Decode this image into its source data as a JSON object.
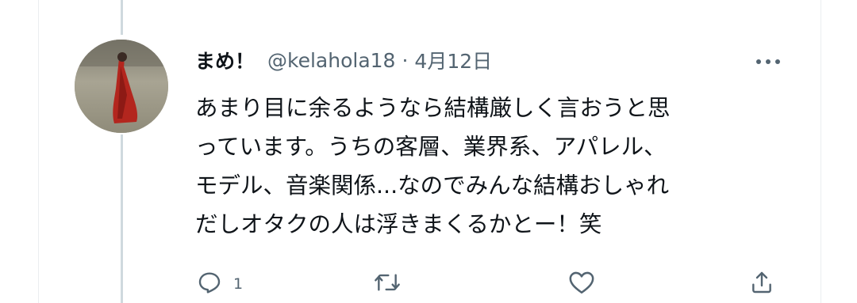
{
  "tweet": {
    "display_name": "まめ！",
    "handle": "@kelahola18",
    "separator": "·",
    "date": "4月12日",
    "text_lines": [
      "あまり目に余るようなら結構厳しく言おうと思",
      "っています。うちの客層、業界系、アパレル、",
      "モデル、音楽関係...なのでみんな結構おしゃれ",
      "だしオタクの人は浮きまくるかとー！笑"
    ],
    "reply_count": "1"
  },
  "icons": {
    "more": "more-icon",
    "reply": "reply-icon",
    "retweet": "retweet-icon",
    "like": "like-icon",
    "share": "share-icon"
  },
  "colors": {
    "text_primary": "#0f1419",
    "text_secondary": "#536471",
    "thread_line": "#cfd9de"
  }
}
